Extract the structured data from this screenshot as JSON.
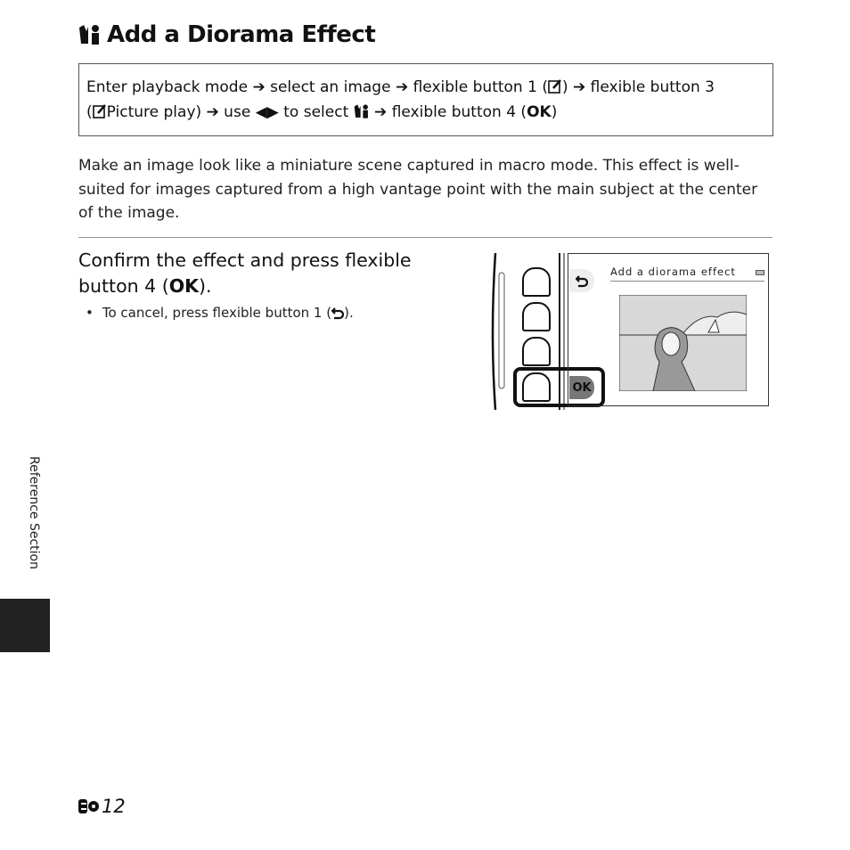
{
  "title": "Add a Diorama Effect",
  "instruction": {
    "s1": "Enter playback mode ➔ select an image ➔ flexible button 1 (",
    "s2": ") ➔ flexible button 3",
    "s3": "(",
    "s4": "Picture play) ➔ use ",
    "s5": " to select ",
    "s6": " ➔ flexible button 4 (",
    "s7": ")"
  },
  "description": "Make an image look like a miniature scene captured in macro mode. This effect is well-suited for images captured from a high vantage point with the main subject at the center of the image.",
  "step": {
    "text_a": "Confirm the effect and press flexible button 4 (",
    "text_b": ")."
  },
  "bullet": {
    "text_a": "To cancel, press flexible button 1 (",
    "text_b": ")."
  },
  "camera_screen": {
    "title": "Add a diorama effect",
    "ok_label": "OK",
    "icons": [
      "back-icon",
      "battery-icon"
    ]
  },
  "side_tab": "Reference Section",
  "page_number": "12",
  "ok_glyph": "OK",
  "arrows": "◀▶"
}
